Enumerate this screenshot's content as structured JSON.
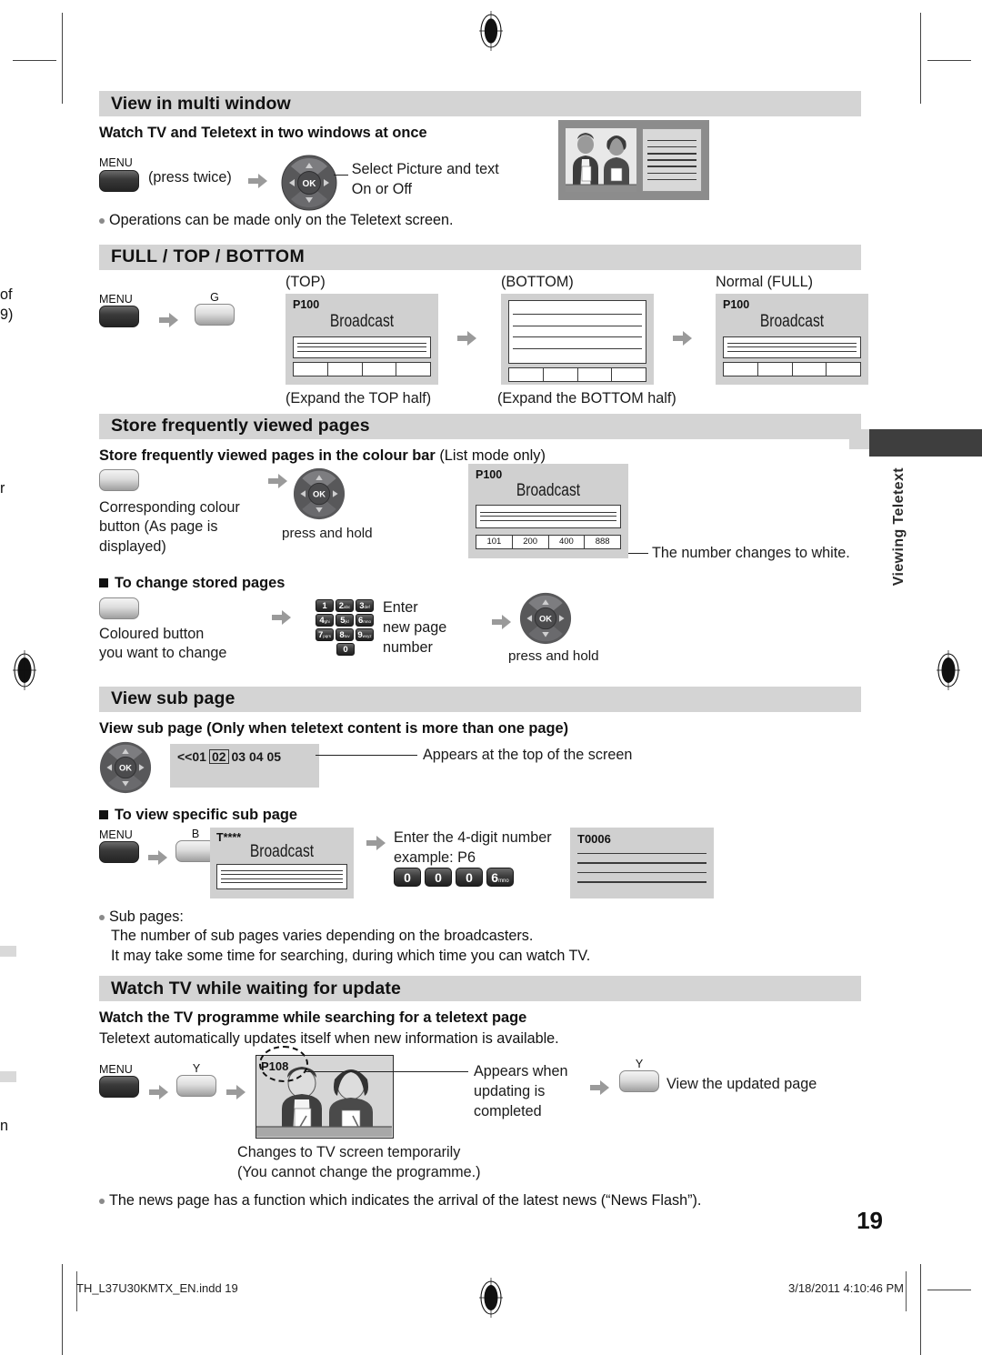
{
  "document": {
    "page_number": "19",
    "side_tab_label": "Viewing Teletext"
  },
  "bleed_left": {
    "frag1": "of",
    "frag2": "9)",
    "frag3": "r",
    "frag4": "n"
  },
  "sections": [
    {
      "id": "multi-window",
      "heading": "View in multi window",
      "subhead": "Watch TV and Teletext in two windows at once",
      "menu_label": "MENU",
      "press_twice": "(press twice)",
      "dpad_note_line1": "Select Picture and text",
      "dpad_note_line2": "On or Off",
      "bullet": "Operations can be made only on the Teletext screen."
    },
    {
      "id": "full-top-bottom",
      "heading": "FULL / TOP / BOTTOM",
      "menu_label": "MENU",
      "green_key_label": "G",
      "state_top": "(TOP)",
      "state_bottom": "(BOTTOM)",
      "state_full": "Normal (FULL)",
      "caption_top": "(Expand the TOP half)",
      "caption_bottom": "(Expand the BOTTOM half)",
      "screen_page_label": "P100",
      "screen_broadcast": "Broadcast"
    },
    {
      "id": "store-pages",
      "heading": "Store frequently viewed pages",
      "subhead_bold": "Store frequently viewed pages in the colour bar",
      "subhead_reg": " (List mode only)",
      "step1_line1": "Corresponding colour",
      "step1_line2": "button (As page is",
      "step1_line3": "displayed)",
      "press_and_hold": "press and hold",
      "screen_page_label": "P100",
      "screen_broadcast": "Broadcast",
      "colour_bar": [
        "101",
        "200",
        "400",
        "888"
      ],
      "callout": "The number changes to white."
    },
    {
      "id": "change-stored",
      "heading": "To change stored pages",
      "step1_line1": "Coloured button",
      "step1_line2": "you want to change",
      "enter_line1": "Enter",
      "enter_line2": "new page",
      "enter_line3": "number",
      "press_and_hold": "press and hold",
      "keypad": [
        [
          {
            "d": "1",
            "s": ""
          },
          {
            "d": "2",
            "s": "abc"
          },
          {
            "d": "3",
            "s": "def"
          }
        ],
        [
          {
            "d": "4",
            "s": "ghi"
          },
          {
            "d": "5",
            "s": "jkl"
          },
          {
            "d": "6",
            "s": "mno"
          }
        ],
        [
          {
            "d": "7",
            "s": "pqrs"
          },
          {
            "d": "8",
            "s": "tuv"
          },
          {
            "d": "9",
            "s": "wxyz"
          }
        ]
      ],
      "keypad_zero": "0"
    },
    {
      "id": "view-sub-page",
      "heading": "View sub page",
      "subhead": "View sub page (Only when teletext content is more than one page)",
      "subpage_prefix": "<<01",
      "subpage_selected": "02",
      "subpage_rest": "03 04 05",
      "callout": "Appears at the top of the screen"
    },
    {
      "id": "specific-sub-page",
      "heading": "To view specific sub page",
      "menu_label": "MENU",
      "blue_key_label": "B",
      "screen_page_label": "T****",
      "screen_broadcast": "Broadcast",
      "instruct_line1": "Enter the 4-digit number",
      "instruct_line2": "example: P6",
      "digits": [
        {
          "d": "0",
          "s": ""
        },
        {
          "d": "0",
          "s": ""
        },
        {
          "d": "0",
          "s": ""
        },
        {
          "d": "6",
          "s": "mno"
        }
      ],
      "result_screen_label": "T0006",
      "note_bullet": "Sub pages:",
      "note_line1": "The number of sub pages varies depending on the broadcasters.",
      "note_line2": "It may take some time for searching, during which time you can watch TV."
    },
    {
      "id": "watch-while-update",
      "heading": "Watch TV while waiting for update",
      "subhead": "Watch the TV programme while searching for a teletext page",
      "para": "Teletext automatically updates itself when new information is available.",
      "menu_label": "MENU",
      "yellow_key_label": "Y",
      "screen_page_label": "P108",
      "callout_line1": "Appears when",
      "callout_line2": "updating is",
      "callout_line3": "completed",
      "view_updated": "View the updated page",
      "note_line1": "Changes to TV screen temporarily",
      "note_line2": "(You cannot change the programme.)",
      "final_bullet": "The news page has a function which indicates the arrival of the latest news (“News Flash”)."
    }
  ],
  "footer": {
    "file_name": "TH_L37U30KMTX_EN.indd   19",
    "timestamp": "3/18/2011   4:10:46 PM"
  }
}
